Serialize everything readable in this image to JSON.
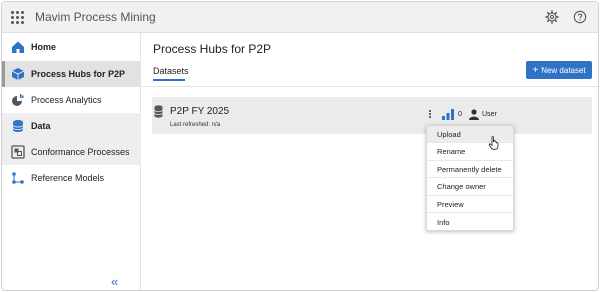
{
  "header": {
    "app_title": "Mavim Process Mining",
    "icons": [
      "app-grid-icon",
      "gear-icon",
      "help-icon"
    ]
  },
  "sidebar": {
    "items": [
      {
        "label": "Home",
        "icon": "home-icon"
      },
      {
        "label": "Process Hubs for P2P",
        "icon": "cube-icon"
      },
      {
        "label": "Process Analytics",
        "icon": "analytics-icon"
      },
      {
        "label": "Data",
        "icon": "database-icon"
      },
      {
        "label": "Conformance Processes",
        "icon": "conformance-icon"
      },
      {
        "label": "Reference Models",
        "icon": "network-icon"
      }
    ],
    "collapse_glyph": "«"
  },
  "main": {
    "title": "Process Hubs for P2P",
    "tabs": [
      {
        "label": "Datasets"
      }
    ],
    "new_dataset_label": "New dataset"
  },
  "dataset": {
    "name": "P2P FY 2025",
    "last_refreshed": "Last refreshed: n/a",
    "count": "0",
    "owner": "User"
  },
  "menu": {
    "items": [
      "Upload",
      "Rename",
      "Permanently delete",
      "Change owner",
      "Preview",
      "Info"
    ]
  },
  "colors": {
    "accent": "#2f73c6",
    "header_bg": "#f1f1f1",
    "row_bg": "#ebebeb"
  }
}
